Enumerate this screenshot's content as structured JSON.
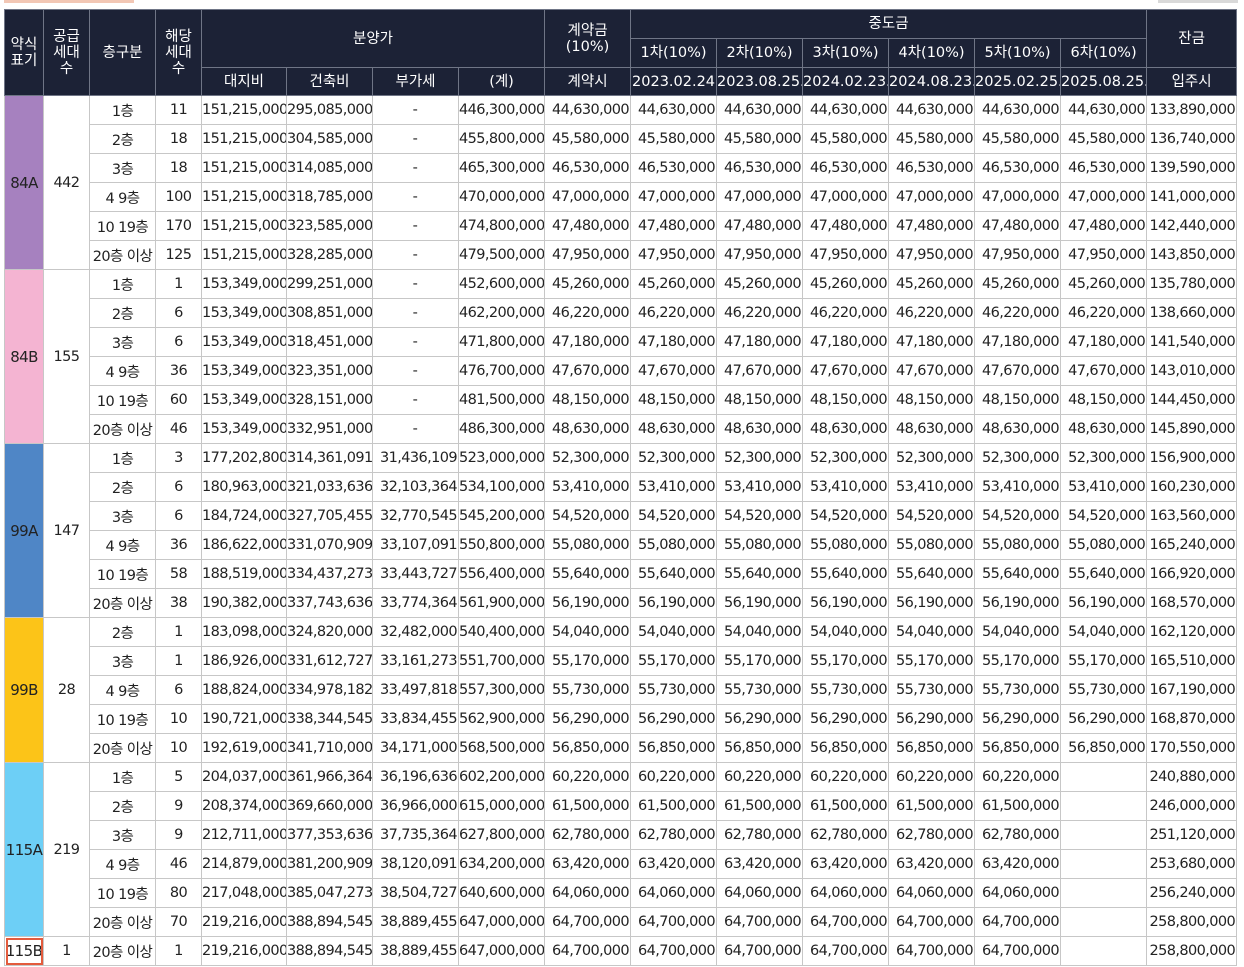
{
  "header": {
    "type_abbr": [
      "약식",
      "표기"
    ],
    "supply_units": [
      "공급",
      "세대",
      "수"
    ],
    "floor_class": "층구분",
    "applicable_units": [
      "해당",
      "세대",
      "수"
    ],
    "sale_price": "분양가",
    "land": "대지비",
    "building": "건축비",
    "vat": "부가세",
    "total": "(계)",
    "deposit": [
      "계약금",
      "(10%)"
    ],
    "deposit_when": "계약시",
    "middle": "중도금",
    "installments": [
      {
        "label": "1차(10%)",
        "date": "2023.02.24"
      },
      {
        "label": "2차(10%)",
        "date": "2023.08.25."
      },
      {
        "label": "3차(10%)",
        "date": "2024.02.23."
      },
      {
        "label": "4차(10%)",
        "date": "2024.08.23."
      },
      {
        "label": "5차(10%)",
        "date": "2025.02.25."
      },
      {
        "label": "6차(10%)",
        "date": "2025.08.25."
      }
    ],
    "balance": "잔금",
    "balance_when": "입주시"
  },
  "groups": [
    {
      "type": "84A",
      "supply": "442",
      "color": "#a681bf",
      "rows": [
        {
          "floor": "1층",
          "units": "11",
          "land": "151,215,000",
          "building": "295,085,000",
          "vat": "-",
          "total": "446,300,000",
          "deposit": "44,630,000",
          "mid": [
            "44,630,000",
            "44,630,000",
            "44,630,000",
            "44,630,000",
            "44,630,000",
            "44,630,000"
          ],
          "balance": "133,890,000"
        },
        {
          "floor": "2층",
          "units": "18",
          "land": "151,215,000",
          "building": "304,585,000",
          "vat": "-",
          "total": "455,800,000",
          "deposit": "45,580,000",
          "mid": [
            "45,580,000",
            "45,580,000",
            "45,580,000",
            "45,580,000",
            "45,580,000",
            "45,580,000"
          ],
          "balance": "136,740,000"
        },
        {
          "floor": "3층",
          "units": "18",
          "land": "151,215,000",
          "building": "314,085,000",
          "vat": "-",
          "total": "465,300,000",
          "deposit": "46,530,000",
          "mid": [
            "46,530,000",
            "46,530,000",
            "46,530,000",
            "46,530,000",
            "46,530,000",
            "46,530,000"
          ],
          "balance": "139,590,000"
        },
        {
          "floor": "4 9층",
          "units": "100",
          "land": "151,215,000",
          "building": "318,785,000",
          "vat": "-",
          "total": "470,000,000",
          "deposit": "47,000,000",
          "mid": [
            "47,000,000",
            "47,000,000",
            "47,000,000",
            "47,000,000",
            "47,000,000",
            "47,000,000"
          ],
          "balance": "141,000,000"
        },
        {
          "floor": "10 19층",
          "units": "170",
          "land": "151,215,000",
          "building": "323,585,000",
          "vat": "-",
          "total": "474,800,000",
          "deposit": "47,480,000",
          "mid": [
            "47,480,000",
            "47,480,000",
            "47,480,000",
            "47,480,000",
            "47,480,000",
            "47,480,000"
          ],
          "balance": "142,440,000"
        },
        {
          "floor": "20층 이상",
          "units": "125",
          "land": "151,215,000",
          "building": "328,285,000",
          "vat": "-",
          "total": "479,500,000",
          "deposit": "47,950,000",
          "mid": [
            "47,950,000",
            "47,950,000",
            "47,950,000",
            "47,950,000",
            "47,950,000",
            "47,950,000"
          ],
          "balance": "143,850,000"
        }
      ]
    },
    {
      "type": "84B",
      "supply": "155",
      "color": "#f4b4d2",
      "rows": [
        {
          "floor": "1층",
          "units": "1",
          "land": "153,349,000",
          "building": "299,251,000",
          "vat": "-",
          "total": "452,600,000",
          "deposit": "45,260,000",
          "mid": [
            "45,260,000",
            "45,260,000",
            "45,260,000",
            "45,260,000",
            "45,260,000",
            "45,260,000"
          ],
          "balance": "135,780,000"
        },
        {
          "floor": "2층",
          "units": "6",
          "land": "153,349,000",
          "building": "308,851,000",
          "vat": "-",
          "total": "462,200,000",
          "deposit": "46,220,000",
          "mid": [
            "46,220,000",
            "46,220,000",
            "46,220,000",
            "46,220,000",
            "46,220,000",
            "46,220,000"
          ],
          "balance": "138,660,000"
        },
        {
          "floor": "3층",
          "units": "6",
          "land": "153,349,000",
          "building": "318,451,000",
          "vat": "-",
          "total": "471,800,000",
          "deposit": "47,180,000",
          "mid": [
            "47,180,000",
            "47,180,000",
            "47,180,000",
            "47,180,000",
            "47,180,000",
            "47,180,000"
          ],
          "balance": "141,540,000"
        },
        {
          "floor": "4 9층",
          "units": "36",
          "land": "153,349,000",
          "building": "323,351,000",
          "vat": "-",
          "total": "476,700,000",
          "deposit": "47,670,000",
          "mid": [
            "47,670,000",
            "47,670,000",
            "47,670,000",
            "47,670,000",
            "47,670,000",
            "47,670,000"
          ],
          "balance": "143,010,000"
        },
        {
          "floor": "10 19층",
          "units": "60",
          "land": "153,349,000",
          "building": "328,151,000",
          "vat": "-",
          "total": "481,500,000",
          "deposit": "48,150,000",
          "mid": [
            "48,150,000",
            "48,150,000",
            "48,150,000",
            "48,150,000",
            "48,150,000",
            "48,150,000"
          ],
          "balance": "144,450,000"
        },
        {
          "floor": "20층 이상",
          "units": "46",
          "land": "153,349,000",
          "building": "332,951,000",
          "vat": "-",
          "total": "486,300,000",
          "deposit": "48,630,000",
          "mid": [
            "48,630,000",
            "48,630,000",
            "48,630,000",
            "48,630,000",
            "48,630,000",
            "48,630,000"
          ],
          "balance": "145,890,000"
        }
      ]
    },
    {
      "type": "99A",
      "supply": "147",
      "color": "#4f86c6",
      "rows": [
        {
          "floor": "1층",
          "units": "3",
          "land": "177,202,800",
          "building": "314,361,091",
          "vat": "31,436,109",
          "total": "523,000,000",
          "deposit": "52,300,000",
          "mid": [
            "52,300,000",
            "52,300,000",
            "52,300,000",
            "52,300,000",
            "52,300,000",
            "52,300,000"
          ],
          "balance": "156,900,000"
        },
        {
          "floor": "2층",
          "units": "6",
          "land": "180,963,000",
          "building": "321,033,636",
          "vat": "32,103,364",
          "total": "534,100,000",
          "deposit": "53,410,000",
          "mid": [
            "53,410,000",
            "53,410,000",
            "53,410,000",
            "53,410,000",
            "53,410,000",
            "53,410,000"
          ],
          "balance": "160,230,000"
        },
        {
          "floor": "3층",
          "units": "6",
          "land": "184,724,000",
          "building": "327,705,455",
          "vat": "32,770,545",
          "total": "545,200,000",
          "deposit": "54,520,000",
          "mid": [
            "54,520,000",
            "54,520,000",
            "54,520,000",
            "54,520,000",
            "54,520,000",
            "54,520,000"
          ],
          "balance": "163,560,000"
        },
        {
          "floor": "4 9층",
          "units": "36",
          "land": "186,622,000",
          "building": "331,070,909",
          "vat": "33,107,091",
          "total": "550,800,000",
          "deposit": "55,080,000",
          "mid": [
            "55,080,000",
            "55,080,000",
            "55,080,000",
            "55,080,000",
            "55,080,000",
            "55,080,000"
          ],
          "balance": "165,240,000"
        },
        {
          "floor": "10 19층",
          "units": "58",
          "land": "188,519,000",
          "building": "334,437,273",
          "vat": "33,443,727",
          "total": "556,400,000",
          "deposit": "55,640,000",
          "mid": [
            "55,640,000",
            "55,640,000",
            "55,640,000",
            "55,640,000",
            "55,640,000",
            "55,640,000"
          ],
          "balance": "166,920,000"
        },
        {
          "floor": "20층 이상",
          "units": "38",
          "land": "190,382,000",
          "building": "337,743,636",
          "vat": "33,774,364",
          "total": "561,900,000",
          "deposit": "56,190,000",
          "mid": [
            "56,190,000",
            "56,190,000",
            "56,190,000",
            "56,190,000",
            "56,190,000",
            "56,190,000"
          ],
          "balance": "168,570,000"
        }
      ]
    },
    {
      "type": "99B",
      "supply": "28",
      "color": "#fcc418",
      "rows": [
        {
          "floor": "2층",
          "units": "1",
          "land": "183,098,000",
          "building": "324,820,000",
          "vat": "32,482,000",
          "total": "540,400,000",
          "deposit": "54,040,000",
          "mid": [
            "54,040,000",
            "54,040,000",
            "54,040,000",
            "54,040,000",
            "54,040,000",
            "54,040,000"
          ],
          "balance": "162,120,000"
        },
        {
          "floor": "3층",
          "units": "1",
          "land": "186,926,000",
          "building": "331,612,727",
          "vat": "33,161,273",
          "total": "551,700,000",
          "deposit": "55,170,000",
          "mid": [
            "55,170,000",
            "55,170,000",
            "55,170,000",
            "55,170,000",
            "55,170,000",
            "55,170,000"
          ],
          "balance": "165,510,000"
        },
        {
          "floor": "4 9층",
          "units": "6",
          "land": "188,824,000",
          "building": "334,978,182",
          "vat": "33,497,818",
          "total": "557,300,000",
          "deposit": "55,730,000",
          "mid": [
            "55,730,000",
            "55,730,000",
            "55,730,000",
            "55,730,000",
            "55,730,000",
            "55,730,000"
          ],
          "balance": "167,190,000"
        },
        {
          "floor": "10 19층",
          "units": "10",
          "land": "190,721,000",
          "building": "338,344,545",
          "vat": "33,834,455",
          "total": "562,900,000",
          "deposit": "56,290,000",
          "mid": [
            "56,290,000",
            "56,290,000",
            "56,290,000",
            "56,290,000",
            "56,290,000",
            "56,290,000"
          ],
          "balance": "168,870,000"
        },
        {
          "floor": "20층 이상",
          "units": "10",
          "land": "192,619,000",
          "building": "341,710,000",
          "vat": "34,171,000",
          "total": "568,500,000",
          "deposit": "56,850,000",
          "mid": [
            "56,850,000",
            "56,850,000",
            "56,850,000",
            "56,850,000",
            "56,850,000",
            "56,850,000"
          ],
          "balance": "170,550,000"
        }
      ]
    },
    {
      "type": "115A",
      "supply": "219",
      "color": "#6dcff6",
      "rows": [
        {
          "floor": "1층",
          "units": "5",
          "land": "204,037,000",
          "building": "361,966,364",
          "vat": "36,196,636",
          "total": "602,200,000",
          "deposit": "60,220,000",
          "mid": [
            "60,220,000",
            "60,220,000",
            "60,220,000",
            "60,220,000",
            "60,220,000",
            ""
          ],
          "balance": "240,880,000"
        },
        {
          "floor": "2층",
          "units": "9",
          "land": "208,374,000",
          "building": "369,660,000",
          "vat": "36,966,000",
          "total": "615,000,000",
          "deposit": "61,500,000",
          "mid": [
            "61,500,000",
            "61,500,000",
            "61,500,000",
            "61,500,000",
            "61,500,000",
            ""
          ],
          "balance": "246,000,000"
        },
        {
          "floor": "3층",
          "units": "9",
          "land": "212,711,000",
          "building": "377,353,636",
          "vat": "37,735,364",
          "total": "627,800,000",
          "deposit": "62,780,000",
          "mid": [
            "62,780,000",
            "62,780,000",
            "62,780,000",
            "62,780,000",
            "62,780,000",
            ""
          ],
          "balance": "251,120,000"
        },
        {
          "floor": "4 9층",
          "units": "46",
          "land": "214,879,000",
          "building": "381,200,909",
          "vat": "38,120,091",
          "total": "634,200,000",
          "deposit": "63,420,000",
          "mid": [
            "63,420,000",
            "63,420,000",
            "63,420,000",
            "63,420,000",
            "63,420,000",
            ""
          ],
          "balance": "253,680,000"
        },
        {
          "floor": "10 19층",
          "units": "80",
          "land": "217,048,000",
          "building": "385,047,273",
          "vat": "38,504,727",
          "total": "640,600,000",
          "deposit": "64,060,000",
          "mid": [
            "64,060,000",
            "64,060,000",
            "64,060,000",
            "64,060,000",
            "64,060,000",
            ""
          ],
          "balance": "256,240,000"
        },
        {
          "floor": "20층 이상",
          "units": "70",
          "land": "219,216,000",
          "building": "388,894,545",
          "vat": "38,889,455",
          "total": "647,000,000",
          "deposit": "64,700,000",
          "mid": [
            "64,700,000",
            "64,700,000",
            "64,700,000",
            "64,700,000",
            "64,700,000",
            ""
          ],
          "balance": "258,800,000"
        }
      ]
    },
    {
      "type": "115B",
      "supply": "1",
      "color": "#ffffff",
      "highlight": true,
      "rows": [
        {
          "floor": "20층 이상",
          "units": "1",
          "land": "219,216,000",
          "building": "388,894,545",
          "vat": "38,889,455",
          "total": "647,000,000",
          "deposit": "64,700,000",
          "mid": [
            "64,700,000",
            "64,700,000",
            "64,700,000",
            "64,700,000",
            "64,700,000",
            ""
          ],
          "balance": "258,800,000"
        }
      ]
    }
  ]
}
